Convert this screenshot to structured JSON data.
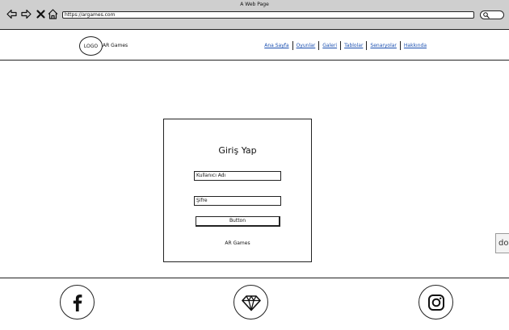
{
  "browser": {
    "window_title": "A Web Page",
    "url": "https://argames.com",
    "nav_icons": [
      "back-arrow-icon",
      "forward-arrow-icon",
      "close-icon",
      "home-icon"
    ],
    "search_icon": "search-icon"
  },
  "header": {
    "logo_text": "LOGO",
    "brand": "AR Games",
    "menu": [
      {
        "label": "Ana Sayfa"
      },
      {
        "label": "Oyunlar"
      },
      {
        "label": "Galeri"
      },
      {
        "label": "Tablolar"
      },
      {
        "label": "Senaryolar"
      },
      {
        "label": "Hakkında"
      }
    ]
  },
  "login": {
    "title": "Giriş Yap",
    "username_value": "Kullanıcı Adı",
    "password_value": "Şifre",
    "button_label": "Button",
    "footer_brand": "AR Games"
  },
  "side_tab": {
    "label": "do"
  },
  "footer": {
    "icons": [
      "facebook-icon",
      "diamond-icon",
      "instagram-icon"
    ]
  },
  "colors": {
    "link": "#1a4fb0",
    "chrome": "#cfcfcf",
    "border": "#222222"
  }
}
